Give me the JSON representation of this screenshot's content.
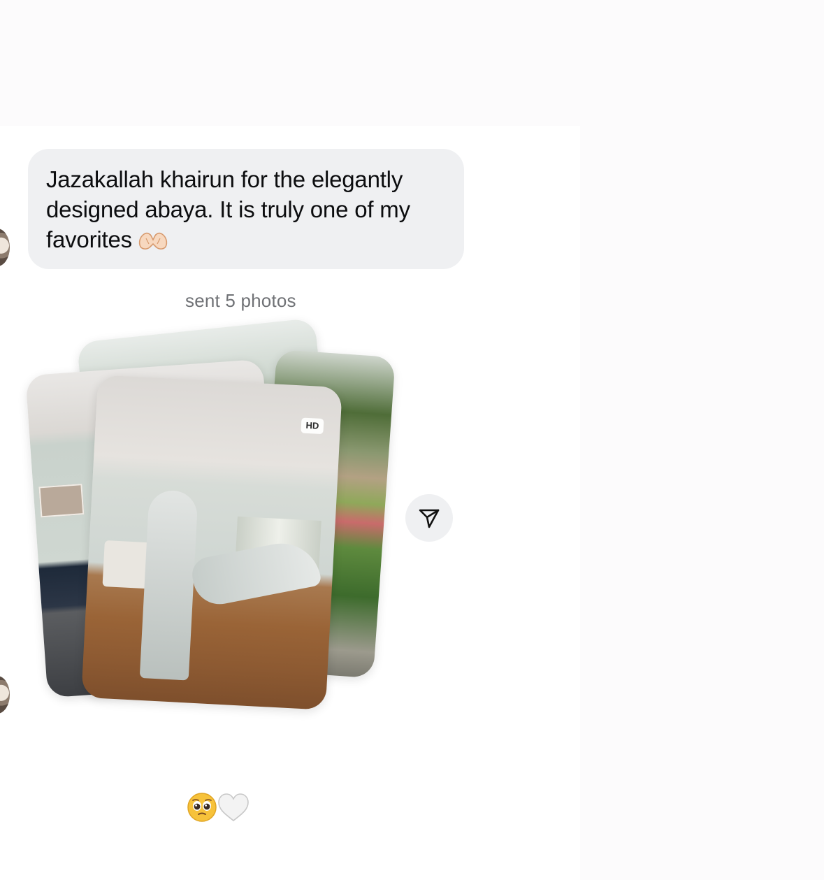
{
  "conversation": {
    "message": {
      "lines": [
        "Jazakallah khairun for the elegantly",
        "designed abaya. It is truly one of my",
        "favorites"
      ],
      "emoji_icon": "heart-hands-icon"
    },
    "photo_note": "sent 5 photos",
    "photo_stack": {
      "count": 5,
      "badge": "HD"
    },
    "share_icon": "send-arrow-icon",
    "reaction": {
      "emojis": [
        "pleading-face-icon",
        "white-heart-icon"
      ]
    }
  },
  "colors": {
    "bubble_background": "#eff0f2",
    "text_primary": "#0c0d0f",
    "text_secondary": "#707276",
    "page_background": "#fcfbfc"
  }
}
